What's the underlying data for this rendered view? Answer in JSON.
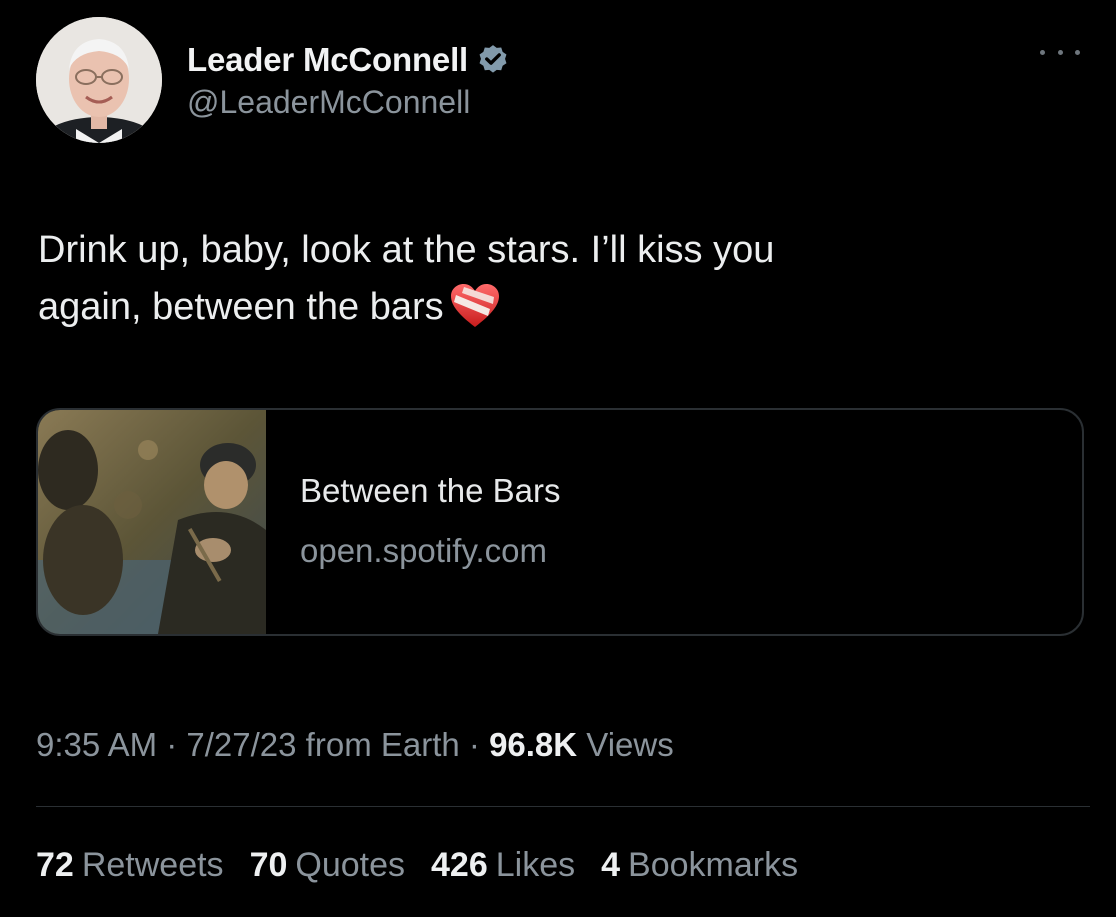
{
  "tweet": {
    "display_name": "Leader McConnell",
    "handle": "@LeaderMcConnell",
    "text_line1": "Drink up, baby, look at the stars. I’ll kiss you",
    "text_line2": "again, between the bars",
    "emoji": "mending-heart-icon"
  },
  "card": {
    "title": "Between the Bars",
    "domain": "open.spotify.com"
  },
  "meta": {
    "time": "9:35 AM",
    "sep1": " · ",
    "date": "7/27/23",
    "source": " from Earth",
    "sep2": " · ",
    "views_count": "96.8K",
    "views_label": " Views"
  },
  "stats": {
    "retweets_count": "72",
    "retweets_label": "Retweets",
    "quotes_count": "70",
    "quotes_label": "Quotes",
    "likes_count": "426",
    "likes_label": "Likes",
    "bookmarks_count": "4",
    "bookmarks_label": "Bookmarks"
  },
  "colors": {
    "background": "#000000",
    "primary_text": "#e7e9ea",
    "secondary_text": "#8b949c",
    "verified_badge": "#829aab",
    "border": "#2a2f33"
  }
}
